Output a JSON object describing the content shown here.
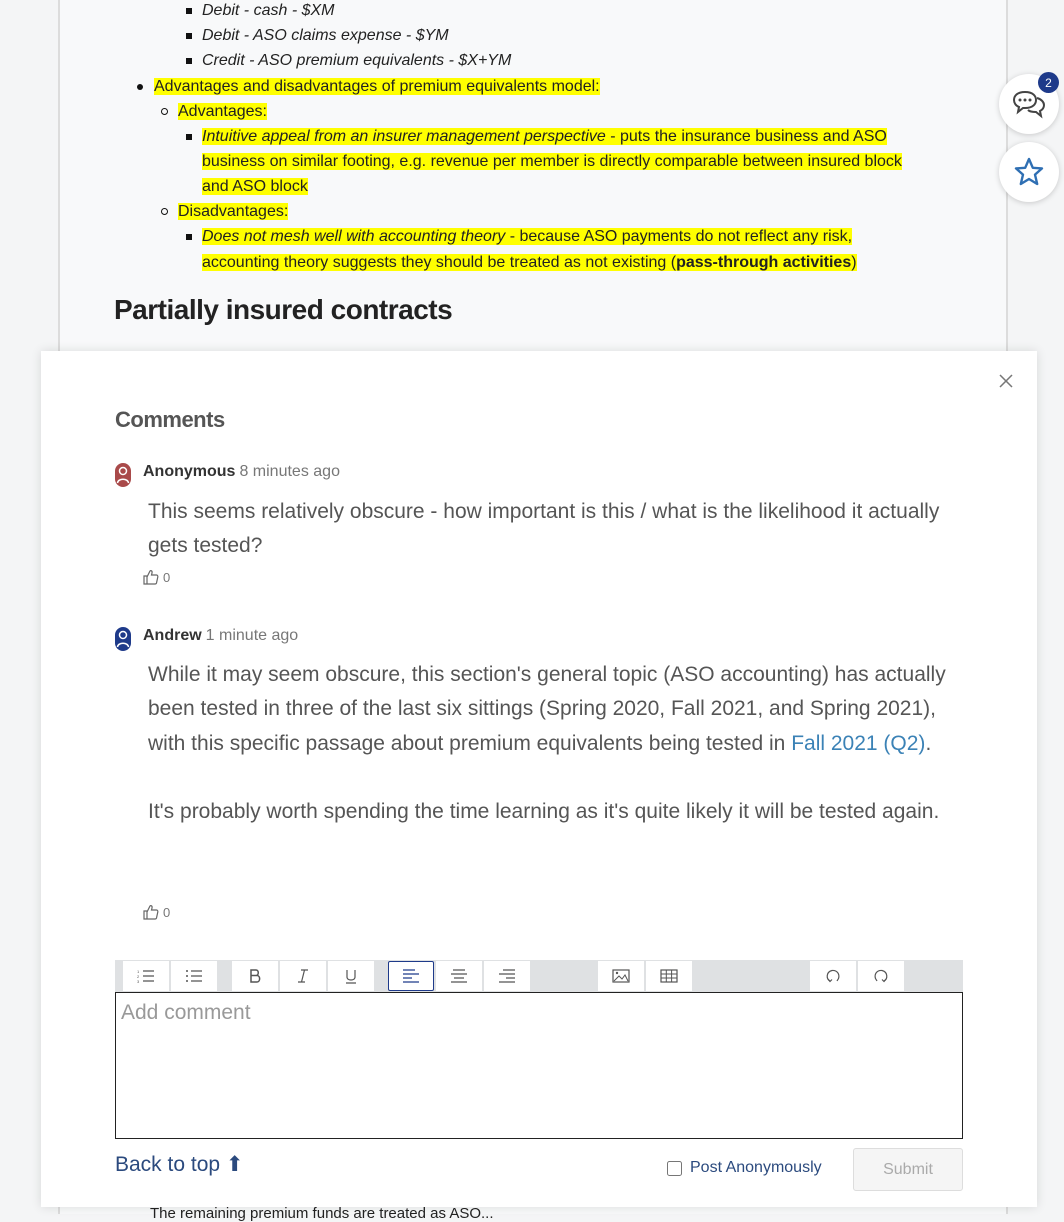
{
  "article": {
    "entries": [
      {
        "label": "Debit - cash - $XM"
      },
      {
        "label": "Debit - ASO claims expense - $YM"
      },
      {
        "label": "Credit - ASO premium equivalents - $X+YM"
      }
    ],
    "adv_disadv_heading": "Advantages and disadvantages of premium equivalents model:",
    "advantages_label": "Advantages:",
    "advantage_italic": "Intuitive appeal from an insurer management perspective",
    "advantage_line1_rest": " - puts the insurance business and ASO",
    "advantage_line2": "business on similar footing, e.g. revenue per member is directly comparable between insured block",
    "advantage_line3": "and ASO block",
    "disadvantages_label": "Disadvantages:",
    "disadvantage_italic": "Does not mesh well with accounting theory",
    "disadvantage_line1_rest": " - because ASO payments do not reflect any risk,",
    "disadvantage_line2_pre": "accounting theory suggests they should be treated as not existing (",
    "disadvantage_bold": "pass-through activities",
    "disadvantage_line2_post": ")",
    "section_heading": "Partially insured contracts",
    "bottom_partial_text": "The remaining premium funds are treated as ASO..."
  },
  "floating": {
    "comments_count": "2"
  },
  "comments_panel": {
    "title": "Comments",
    "comments": [
      {
        "author": "Anonymous",
        "time": "8 minutes ago",
        "avatar_color": "#a94a4a",
        "paragraphs": [
          "This seems relatively obscure - how important is this / what is the likelihood it actually gets tested?"
        ],
        "likes": "0"
      },
      {
        "author": "Andrew",
        "time": "1 minute ago",
        "avatar_color": "#1e3a8a",
        "p1_pre": "While it may seem obscure, this section's general topic (ASO accounting) has actually been tested in three of the last six sittings (Spring 2020, Fall 2021, and Spring 2021), with this specific passage about premium equivalents being tested in ",
        "p1_link": "Fall 2021 (Q2)",
        "p1_post": ".",
        "p2": "It's probably worth spending the time learning as it's quite likely it will be tested again.",
        "likes": "0"
      }
    ],
    "editor": {
      "placeholder": "Add comment",
      "toolbar": [
        "ordered-list",
        "bullet-list",
        "bold",
        "italic",
        "underline",
        "align-left",
        "align-center",
        "align-right",
        "image",
        "table",
        "undo",
        "redo"
      ]
    },
    "back_to_top": "Back to top ⬆",
    "post_anonymously": "Post Anonymously",
    "submit": "Submit"
  }
}
